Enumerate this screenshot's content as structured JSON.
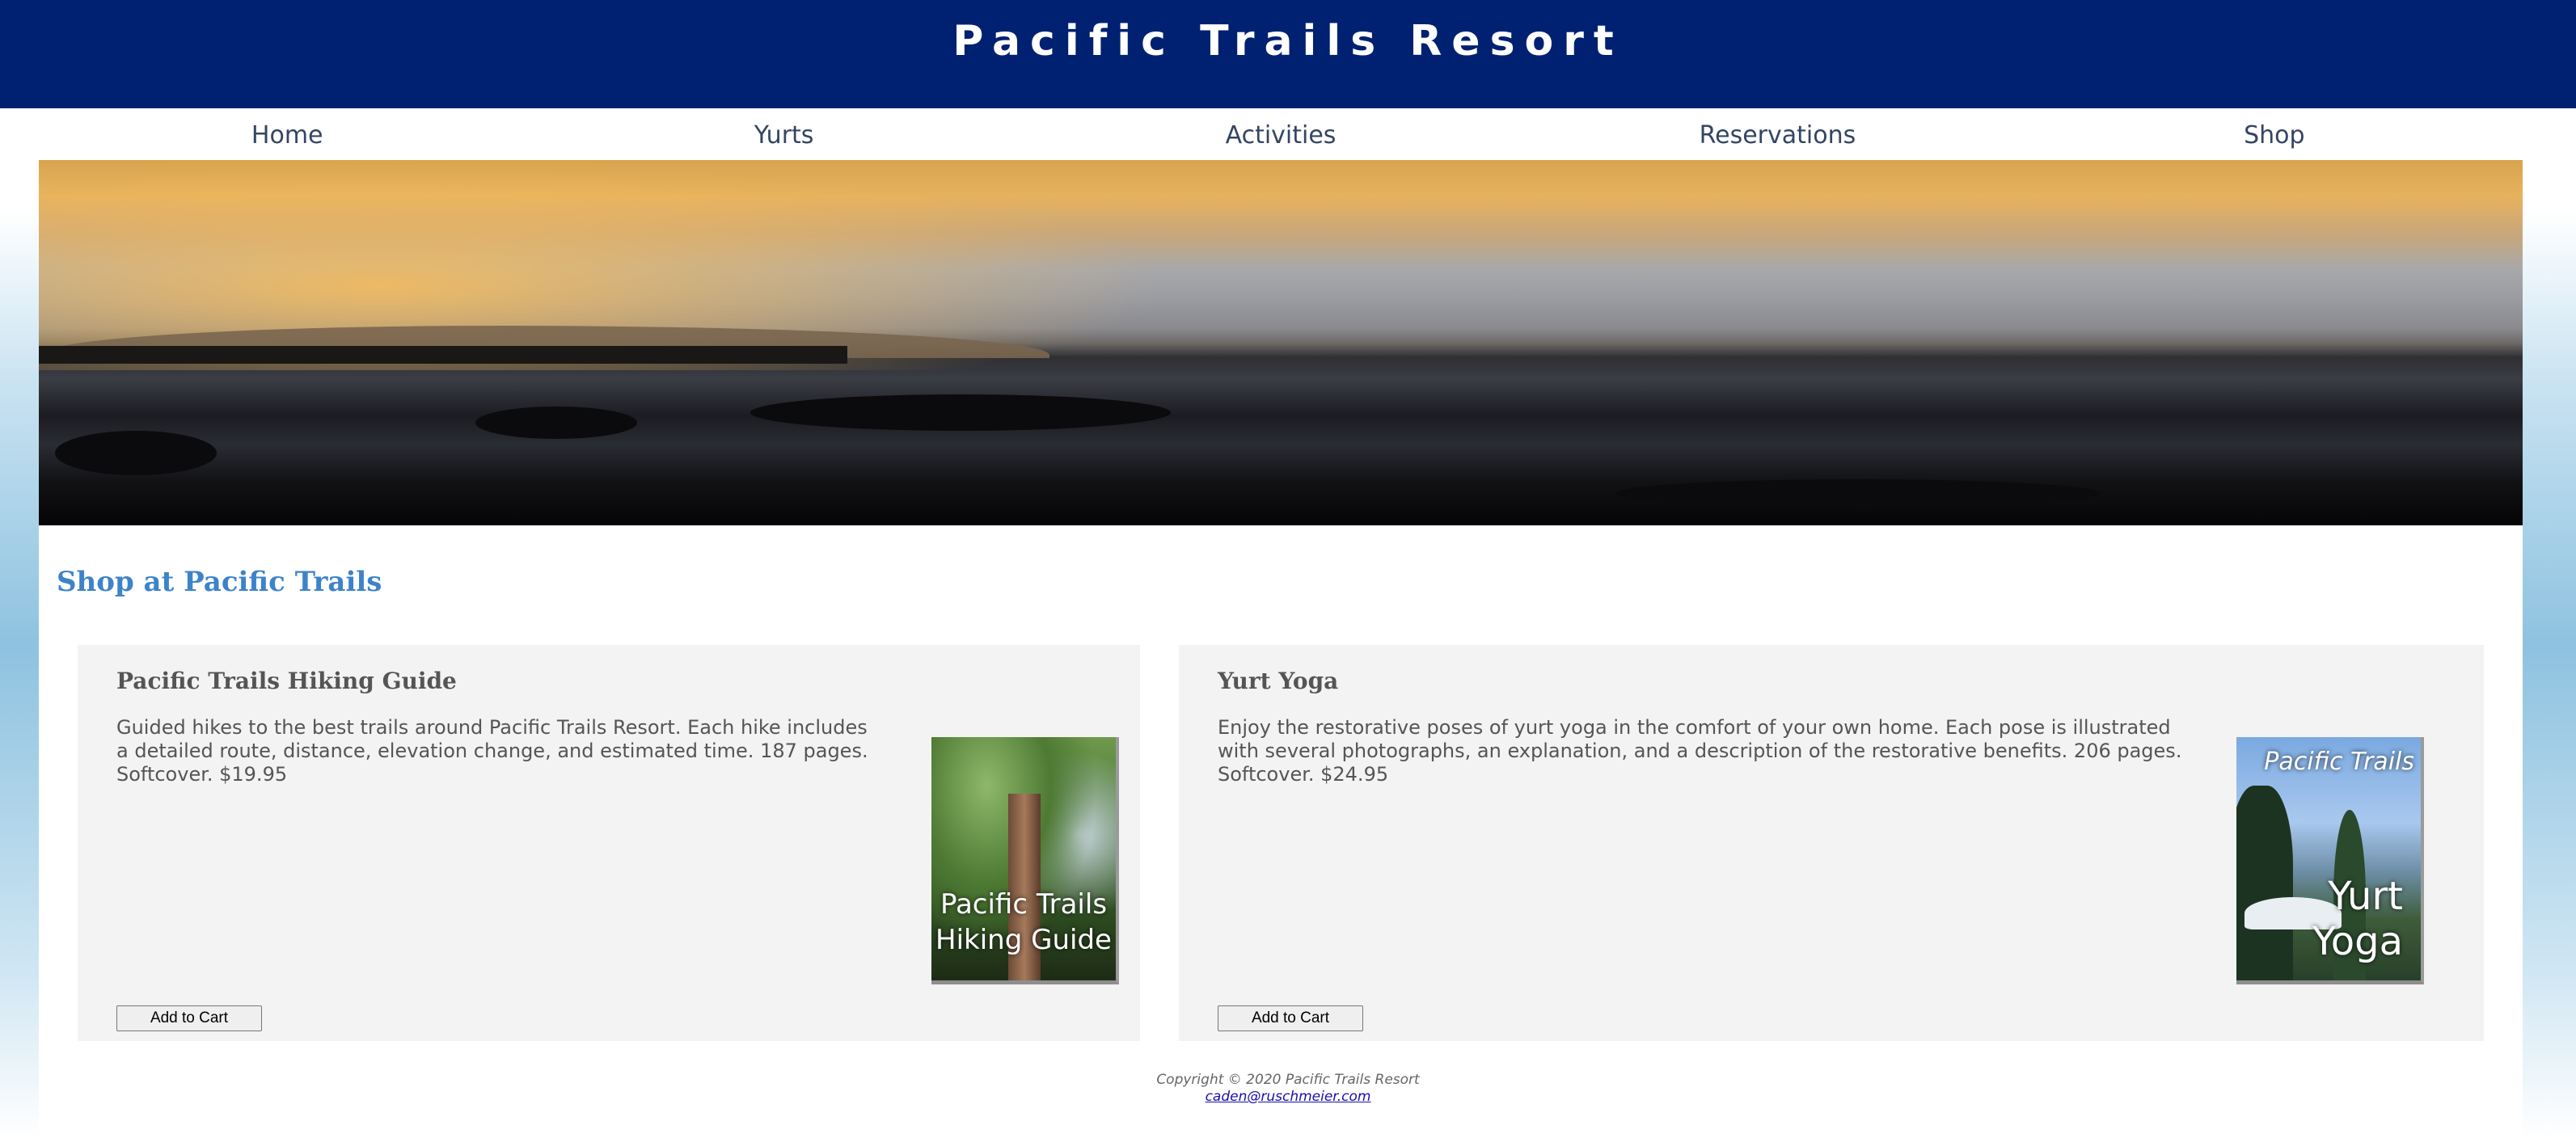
{
  "site": {
    "title": "Pacific Trails Resort"
  },
  "nav": {
    "items": [
      {
        "label": "Home"
      },
      {
        "label": "Yurts"
      },
      {
        "label": "Activities"
      },
      {
        "label": "Reservations"
      },
      {
        "label": "Shop"
      }
    ]
  },
  "main": {
    "heading": "Shop at Pacific Trails",
    "products": [
      {
        "name": "Pacific Trails Hiking Guide",
        "description": "Guided hikes to the best trails around Pacific Trails Resort. Each hike includes a detailed route, distance, elevation change, and estimated time. 187 pages. Softcover. $19.95",
        "cover_line1": "Pacific Trails",
        "cover_line2": "Hiking Guide",
        "button_label": "Add to Cart"
      },
      {
        "name": "Yurt Yoga",
        "description": "Enjoy the restorative poses of yurt yoga in the comfort of your own home. Each pose is illustrated with several photographs, an explanation, and a description of the restorative benefits. 206 pages. Softcover. $24.95",
        "cover_brand": "Pacific Trails",
        "cover_line1": "Yurt",
        "cover_line2": "Yoga",
        "button_label": "Add to Cart"
      }
    ]
  },
  "footer": {
    "copyright": "Copyright © 2020 Pacific Trails Resort",
    "email": "caden@ruschmeier.com"
  },
  "colors": {
    "header_bg": "#002171",
    "heading": "#3d83c9",
    "panel_bg": "#f3f3f3",
    "nav_text": "#344563"
  }
}
